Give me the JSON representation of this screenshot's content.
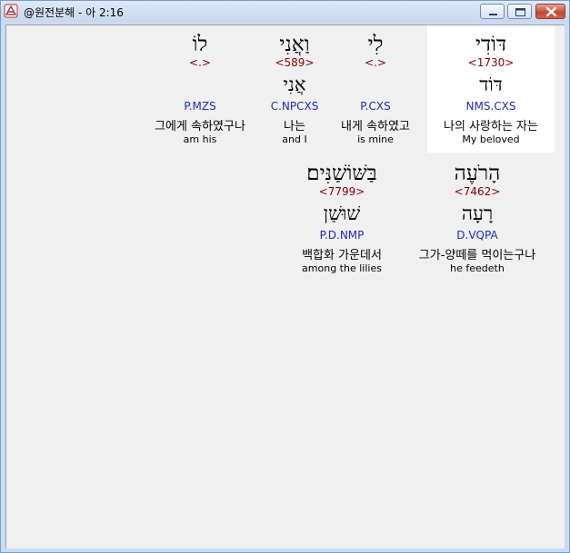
{
  "window": {
    "title": "@원전분해 - 아 2:16",
    "icon": "app-icon",
    "buttons": [
      "minimize-icon",
      "maximize-icon",
      "close-icon"
    ]
  },
  "verse": {
    "rows": [
      {
        "words": [
          {
            "hebrew": "דּוֹדִי",
            "strong": "<1730>",
            "lemma": "דּוֹד",
            "parse": "NMS.CXS",
            "korean": "나의 사랑하는 자는",
            "english": "My beloved",
            "highlighted": true
          },
          {
            "hebrew": "לִי",
            "strong": "<.>",
            "lemma": "",
            "parse": "P.CXS",
            "korean": "내게 속하였고",
            "english": "is mine",
            "highlighted": false
          },
          {
            "hebrew": "וַאֲנִי",
            "strong": "<589>",
            "lemma": "אֲנִי",
            "parse": "C.NPCXS",
            "korean": "나는",
            "english": "and I",
            "highlighted": false
          },
          {
            "hebrew": "לוֹ",
            "strong": "<.>",
            "lemma": "",
            "parse": "P.MZS",
            "korean": "그에게 속하였구나",
            "english": "am his",
            "highlighted": false
          }
        ]
      },
      {
        "words": [
          {
            "hebrew": "הָרֹעֶה",
            "strong": "<7462>",
            "lemma": "רָעָה",
            "parse": "D.VQPA",
            "korean": "그가-양떼를 먹이는구나",
            "english": "he feedeth",
            "highlighted": false
          },
          {
            "hebrew": "בַּשּׁוֹשַׁנִּים׃",
            "strong": "<7799>",
            "lemma": "שׁוּשַׁן",
            "parse": "P.D.NMP",
            "korean": "백합화 가운데서",
            "english": "among the lilies",
            "highlighted": false
          }
        ]
      }
    ]
  },
  "colors": {
    "strong": "#8b0000",
    "parse": "#1a2fb0",
    "highlight": "#ffffff",
    "background": "#f0f0f0"
  }
}
